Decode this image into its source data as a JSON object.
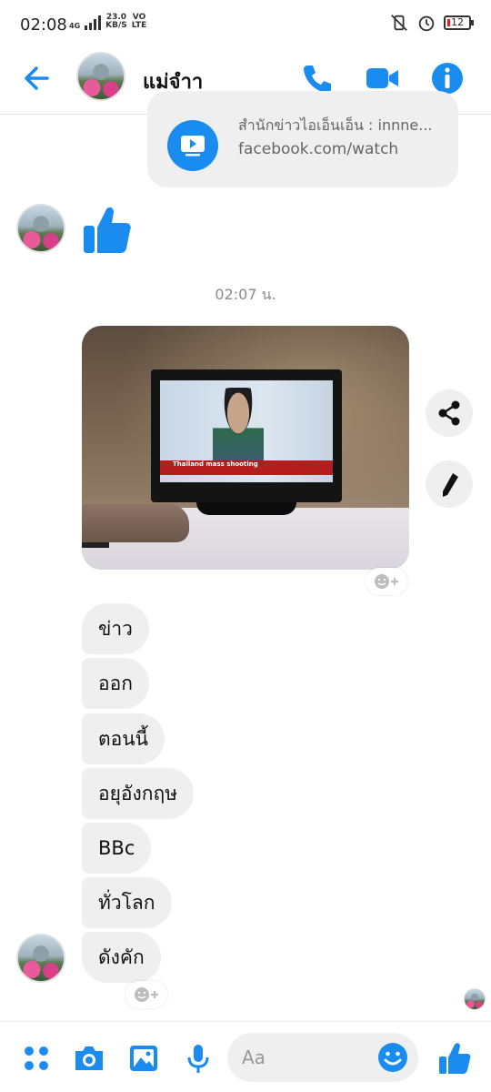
{
  "status_bar": {
    "time": "02:08",
    "network_type": "4G",
    "speed_value": "23.0",
    "speed_unit": "KB/S",
    "volte_top": "VO",
    "volte_bottom": "LTE",
    "battery": "12"
  },
  "header": {
    "contact_name": "แม่จำา",
    "icons": [
      "back-arrow-icon",
      "phone-icon",
      "video-camera-icon",
      "info-icon"
    ]
  },
  "link_card": {
    "title": "สำนักข่าวไอเอ็นเอ็น : innne...",
    "url": "facebook.com/watch",
    "icon": "video-play-icon"
  },
  "timestamp": "02:07 น.",
  "photo_overlay": {
    "news_caption": "Thailand mass shooting"
  },
  "messages": [
    {
      "text": "ข่าว"
    },
    {
      "text": "ออก"
    },
    {
      "text": "ตอนนี้"
    },
    {
      "text": "อยุอังกฤษ"
    },
    {
      "text": "BBc"
    },
    {
      "text": "ทั่วโลก"
    },
    {
      "text": "ดังคัก"
    }
  ],
  "composer": {
    "placeholder": "Aa"
  },
  "colors": {
    "accent": "#1a8cf0",
    "bubble": "#efefef",
    "timestamp": "#8a8a8a"
  }
}
